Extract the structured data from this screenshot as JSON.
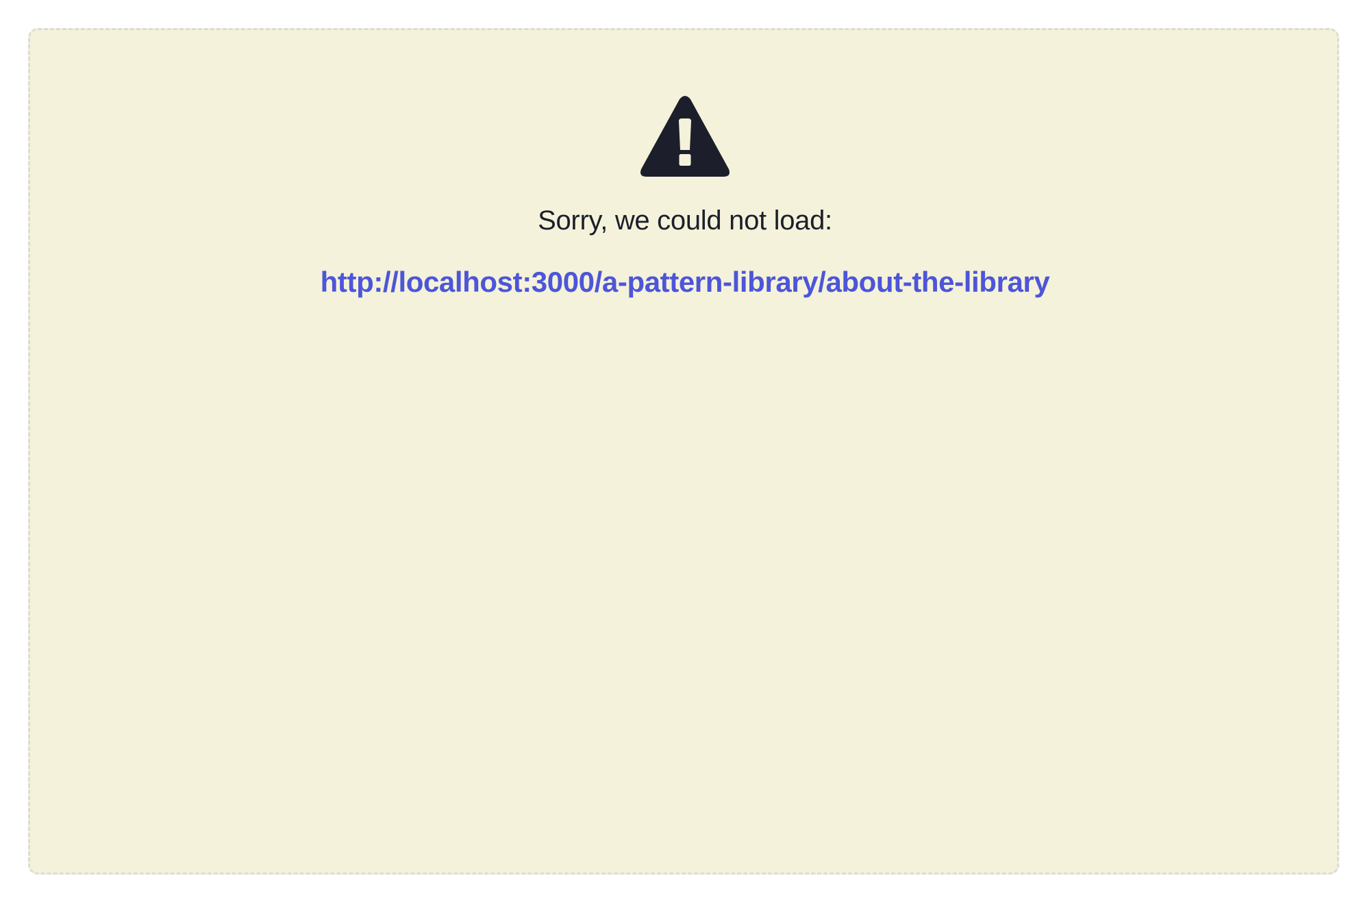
{
  "error_panel": {
    "icon": "warning-triangle-icon",
    "message": "Sorry, we could not load:",
    "url": "http://localhost:3000/a-pattern-library/about-the-library"
  },
  "colors": {
    "panel_background": "#f4f2da",
    "panel_border": "#dcdcd6",
    "icon": "#1c1f2b",
    "text": "#1c1f2b",
    "link": "#4d55d9"
  }
}
